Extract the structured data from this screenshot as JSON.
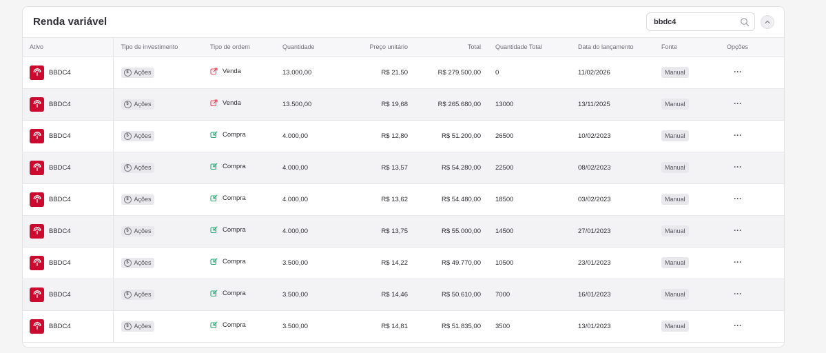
{
  "header": {
    "title": "Renda variável"
  },
  "search": {
    "value": "bbdc4",
    "icon": "search-icon"
  },
  "collapse": {
    "icon": "chevron-up-icon"
  },
  "columns": {
    "ativo": "Ativo",
    "tipo_investimento": "Tipo de investimento",
    "tipo_ordem": "Tipo de ordem",
    "quantidade": "Quantidade",
    "preco_unitario": "Preço unitário",
    "total": "Total",
    "quantidade_total": "Quantidade Total",
    "data_lancamento": "Data do lançamento",
    "fonte": "Fonte",
    "opcoes": "Opções"
  },
  "colors": {
    "brand": "#cc092f",
    "venda": "#e8455c",
    "compra": "#2aa876"
  },
  "rows": [
    {
      "ativo": "BBDC4",
      "tipo": "Ações",
      "ordem": "Venda",
      "ordem_type": "venda",
      "quantidade": "13.000,00",
      "preco": "R$ 21,50",
      "total": "R$ 279.500,00",
      "qtd_total": "0",
      "data": "11/02/2026",
      "fonte": "Manual"
    },
    {
      "ativo": "BBDC4",
      "tipo": "Ações",
      "ordem": "Venda",
      "ordem_type": "venda",
      "quantidade": "13.500,00",
      "preco": "R$ 19,68",
      "total": "R$ 265.680,00",
      "qtd_total": "13000",
      "data": "13/11/2025",
      "fonte": "Manual"
    },
    {
      "ativo": "BBDC4",
      "tipo": "Ações",
      "ordem": "Compra",
      "ordem_type": "compra",
      "quantidade": "4.000,00",
      "preco": "R$ 12,80",
      "total": "R$ 51.200,00",
      "qtd_total": "26500",
      "data": "10/02/2023",
      "fonte": "Manual"
    },
    {
      "ativo": "BBDC4",
      "tipo": "Ações",
      "ordem": "Compra",
      "ordem_type": "compra",
      "quantidade": "4.000,00",
      "preco": "R$ 13,57",
      "total": "R$ 54.280,00",
      "qtd_total": "22500",
      "data": "08/02/2023",
      "fonte": "Manual"
    },
    {
      "ativo": "BBDC4",
      "tipo": "Ações",
      "ordem": "Compra",
      "ordem_type": "compra",
      "quantidade": "4.000,00",
      "preco": "R$ 13,62",
      "total": "R$ 54.480,00",
      "qtd_total": "18500",
      "data": "03/02/2023",
      "fonte": "Manual"
    },
    {
      "ativo": "BBDC4",
      "tipo": "Ações",
      "ordem": "Compra",
      "ordem_type": "compra",
      "quantidade": "4.000,00",
      "preco": "R$ 13,75",
      "total": "R$ 55.000,00",
      "qtd_total": "14500",
      "data": "27/01/2023",
      "fonte": "Manual"
    },
    {
      "ativo": "BBDC4",
      "tipo": "Ações",
      "ordem": "Compra",
      "ordem_type": "compra",
      "quantidade": "3.500,00",
      "preco": "R$ 14,22",
      "total": "R$ 49.770,00",
      "qtd_total": "10500",
      "data": "23/01/2023",
      "fonte": "Manual"
    },
    {
      "ativo": "BBDC4",
      "tipo": "Ações",
      "ordem": "Compra",
      "ordem_type": "compra",
      "quantidade": "3.500,00",
      "preco": "R$ 14,46",
      "total": "R$ 50.610,00",
      "qtd_total": "7000",
      "data": "16/01/2023",
      "fonte": "Manual"
    },
    {
      "ativo": "BBDC4",
      "tipo": "Ações",
      "ordem": "Compra",
      "ordem_type": "compra",
      "quantidade": "3.500,00",
      "preco": "R$ 14,81",
      "total": "R$ 51.835,00",
      "qtd_total": "3500",
      "data": "13/01/2023",
      "fonte": "Manual"
    }
  ]
}
